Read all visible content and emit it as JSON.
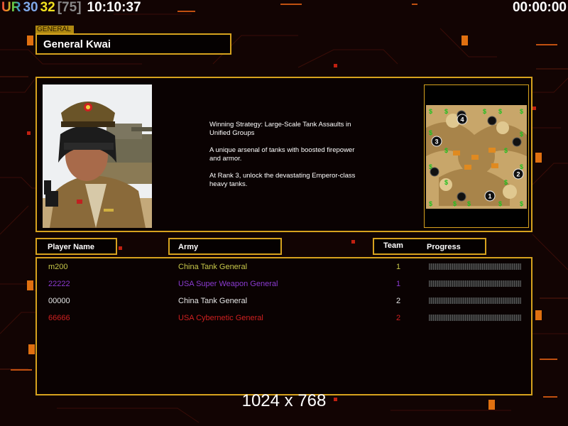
{
  "hud": {
    "player_label": "UR",
    "stat_blue": "30",
    "stat_yellow": "32",
    "stat_gray": "[75]",
    "clock": "10:10:37",
    "timer": "00:00:00"
  },
  "general": {
    "tab_label": "GENERAL",
    "name": "General Kwai",
    "description": [
      "Winning Strategy: Large-Scale Tank Assaults in\n Unified Groups",
      "A unique arsenal of tanks with boosted firepower\n and armor.",
      "At Rank 3, unlock the devastating Emperor-class\n heavy tanks."
    ]
  },
  "columns": {
    "player": "Player Name",
    "army": "Army",
    "team": "Team",
    "progress": "Progress"
  },
  "players": [
    {
      "name": "m200",
      "army": "China Tank General",
      "team": "1",
      "color": "#c8c84a",
      "progress": 0
    },
    {
      "name": "22222",
      "army": "USA Super Weapon General",
      "team": "1",
      "color": "#8a3ad0",
      "progress": 0
    },
    {
      "name": "00000",
      "army": "China Tank General",
      "team": "2",
      "color": "#e6e6e6",
      "progress": 0
    },
    {
      "name": "66666",
      "army": "USA Cybernetic General",
      "team": "2",
      "color": "#d02020",
      "progress": 0
    }
  ],
  "minimap": {
    "start_positions": [
      "1",
      "2",
      "3",
      "4"
    ]
  },
  "resolution": "1024 x 768",
  "colors": {
    "accent": "#d6a21e",
    "background": "#120403",
    "hud_ur": "#ffffff",
    "hud_blue": "#7fa8e8",
    "hud_yellow": "#f0e020",
    "hud_gray": "#888888"
  }
}
